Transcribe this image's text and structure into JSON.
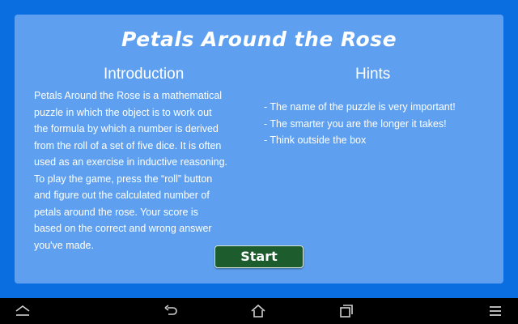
{
  "app": {
    "title": "Petals Around the Rose"
  },
  "introduction": {
    "heading": "Introduction",
    "lines": [
      "Petals Around the Rose is a mathematical",
      "puzzle in which the object is to work out",
      "the formula by which a number is derived",
      "from the roll of a set of five dice. It is often",
      "used as an exercise in inductive reasoning.",
      "To play the game, press the “roll” button",
      "and figure out the calculated number of",
      "petals around the rose. Your score is",
      "based on the correct and wrong answer",
      "you've made."
    ]
  },
  "hints": {
    "heading": "Hints",
    "items": [
      "- The name of the puzzle is very important!",
      "- The smarter you are the longer it takes!",
      "- Think outside the box"
    ]
  },
  "start_button": {
    "label": "Start"
  },
  "navbar": {
    "icons": [
      "collapse-icon",
      "back-icon",
      "home-icon",
      "recent-apps-icon",
      "menu-icon"
    ]
  },
  "colors": {
    "background": "#0a6de0",
    "panel": "#5ea0ef",
    "button": "#1d5c2c",
    "text": "#ffffff",
    "navbar": "#000000"
  }
}
